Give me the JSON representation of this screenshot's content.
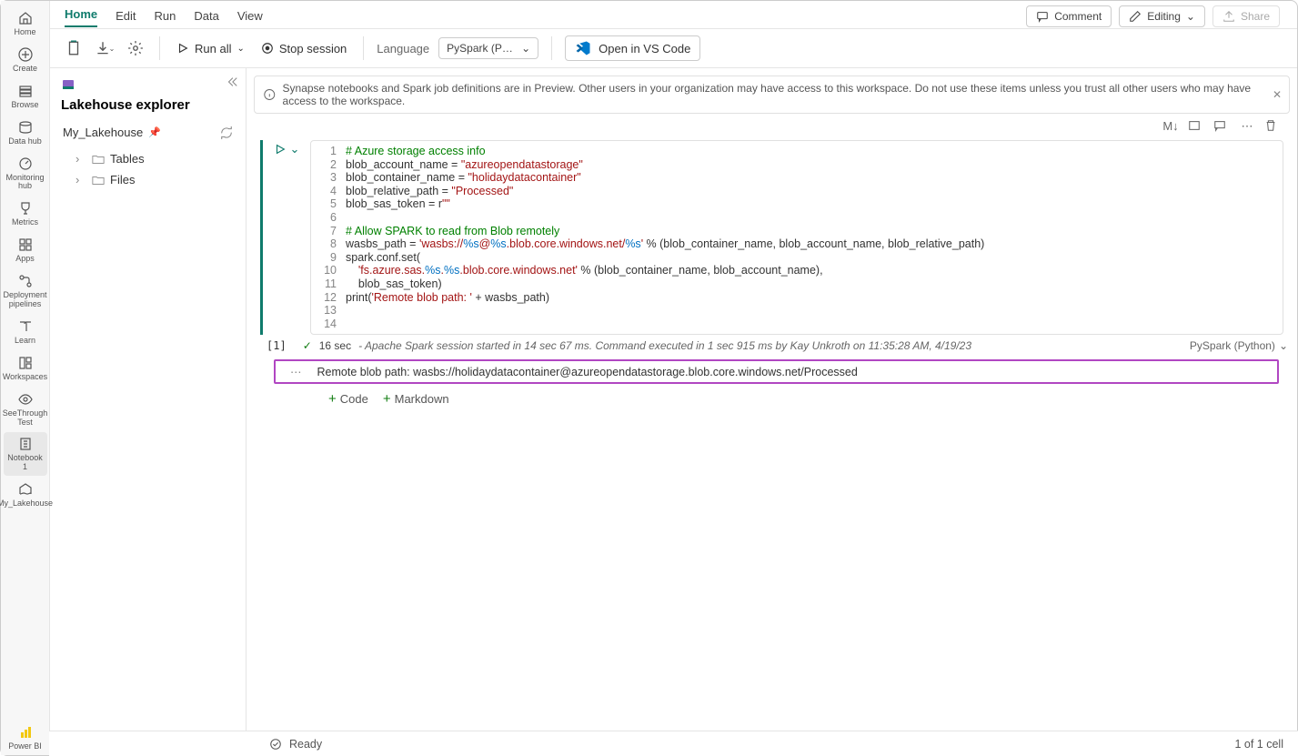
{
  "nav": {
    "items": [
      {
        "label": "Home",
        "icon": "home"
      },
      {
        "label": "Create",
        "icon": "plus-circle"
      },
      {
        "label": "Browse",
        "icon": "stack"
      },
      {
        "label": "Data hub",
        "icon": "database"
      },
      {
        "label": "Monitoring hub",
        "icon": "gauge"
      },
      {
        "label": "Metrics",
        "icon": "trophy"
      },
      {
        "label": "Apps",
        "icon": "grid"
      },
      {
        "label": "Deployment pipelines",
        "icon": "pipeline"
      },
      {
        "label": "Learn",
        "icon": "book"
      },
      {
        "label": "Workspaces",
        "icon": "workspaces"
      },
      {
        "label": "SeeThrough Test",
        "icon": "eye"
      },
      {
        "label": "Notebook 1",
        "icon": "notebook"
      },
      {
        "label": "My_Lakehouse",
        "icon": "lakehouse"
      },
      {
        "label": "Power BI",
        "icon": "powerbi"
      }
    ]
  },
  "tabs": [
    "Home",
    "Edit",
    "Run",
    "Data",
    "View"
  ],
  "top_right": {
    "comment": "Comment",
    "editing": "Editing",
    "share": "Share"
  },
  "toolbar": {
    "run_all": "Run all",
    "stop_session": "Stop session",
    "language_label": "Language",
    "language_value": "PySpark (Pytho...",
    "vscode": "Open in VS Code"
  },
  "sidebar": {
    "title": "Lakehouse explorer",
    "lakehouse": "My_Lakehouse",
    "nodes": [
      "Tables",
      "Files"
    ]
  },
  "info_bar": "Synapse notebooks and Spark job definitions are in Preview. Other users in your organization may have access to this workspace. Do not use these items unless you trust all other users who may have access to the workspace.",
  "cell": {
    "line_count": 14,
    "code_lines": [
      [
        {
          "t": "# Azure storage access info",
          "c": "c-comment"
        }
      ],
      [
        {
          "t": "blob_account_name = ",
          "c": "c-var"
        },
        {
          "t": "\"azureopendatastorage\"",
          "c": "c-str"
        }
      ],
      [
        {
          "t": "blob_container_name = ",
          "c": "c-var"
        },
        {
          "t": "\"holidaydatacontainer\"",
          "c": "c-str"
        }
      ],
      [
        {
          "t": "blob_relative_path = ",
          "c": "c-var"
        },
        {
          "t": "\"Processed\"",
          "c": "c-str"
        }
      ],
      [
        {
          "t": "blob_sas_token = r",
          "c": "c-var"
        },
        {
          "t": "\"\"",
          "c": "c-str"
        }
      ],
      [
        {
          "t": "",
          "c": "c-var"
        }
      ],
      [
        {
          "t": "# Allow SPARK to read from Blob remotely",
          "c": "c-comment"
        }
      ],
      [
        {
          "t": "wasbs_path = ",
          "c": "c-var"
        },
        {
          "t": "'wasbs://",
          "c": "c-str"
        },
        {
          "t": "%s",
          "c": "c-fmt"
        },
        {
          "t": "@",
          "c": "c-str"
        },
        {
          "t": "%s",
          "c": "c-fmt"
        },
        {
          "t": ".blob.core.windows.net/",
          "c": "c-str"
        },
        {
          "t": "%s",
          "c": "c-fmt"
        },
        {
          "t": "'",
          "c": "c-str"
        },
        {
          "t": " % (blob_container_name, blob_account_name, blob_relative_path)",
          "c": "c-var"
        }
      ],
      [
        {
          "t": "spark.conf.set(",
          "c": "c-var"
        }
      ],
      [
        {
          "t": "    ",
          "c": "c-var"
        },
        {
          "t": "'fs.azure.sas.",
          "c": "c-str"
        },
        {
          "t": "%s",
          "c": "c-fmt"
        },
        {
          "t": ".",
          "c": "c-str"
        },
        {
          "t": "%s",
          "c": "c-fmt"
        },
        {
          "t": ".blob.core.windows.net'",
          "c": "c-str"
        },
        {
          "t": " % (blob_container_name, blob_account_name),",
          "c": "c-var"
        }
      ],
      [
        {
          "t": "    blob_sas_token)",
          "c": "c-var"
        }
      ],
      [
        {
          "t": "print(",
          "c": "c-var"
        },
        {
          "t": "'Remote blob path: '",
          "c": "c-str"
        },
        {
          "t": " + wasbs_path)",
          "c": "c-var"
        }
      ],
      [
        {
          "t": "",
          "c": "c-var"
        }
      ],
      [
        {
          "t": "",
          "c": "c-var"
        }
      ]
    ],
    "exec_index": "[1]",
    "exec_duration": "16 sec",
    "exec_msg": "- Apache Spark session started in 14 sec 67 ms. Command executed in 1 sec 915 ms by Kay Unkroth on 11:35:28 AM, 4/19/23",
    "lang": "PySpark (Python)",
    "output": "Remote blob path: wasbs://holidaydatacontainer@azureopendatastorage.blob.core.windows.net/Processed"
  },
  "add": {
    "code": "Code",
    "markdown": "Markdown"
  },
  "statusbar": {
    "ready": "Ready",
    "cells": "1 of 1 cell"
  }
}
